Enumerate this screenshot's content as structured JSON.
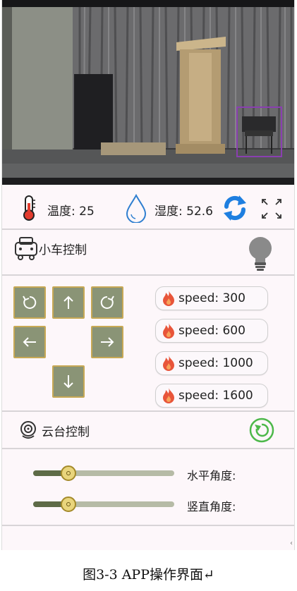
{
  "camera": {
    "feed_name": "camera-feed"
  },
  "sensors": {
    "temperature_label": "温度: 25",
    "humidity_label": "湿度: 52.6",
    "refresh_icon": "refresh-icon",
    "fullscreen_icon": "fullscreen-icon"
  },
  "car_control": {
    "title": "小车控制",
    "light_icon": "lightbulb-icon",
    "directions": [
      {
        "name": "rotate-left",
        "glyph": "⟲"
      },
      {
        "name": "forward",
        "glyph": "↑"
      },
      {
        "name": "rotate-right",
        "glyph": "⟳"
      },
      {
        "name": "left",
        "glyph": "←"
      },
      {
        "name": "right",
        "glyph": "→"
      },
      {
        "name": "backward",
        "glyph": "↓"
      }
    ],
    "speeds": [
      "speed: 300",
      "speed: 600",
      "speed: 1000",
      "speed: 1600"
    ]
  },
  "gimbal_control": {
    "title": "云台控制",
    "horizontal_label": "水平角度:",
    "vertical_label": "竖直角度:",
    "horizontal_value": 0.25,
    "vertical_value": 0.25
  },
  "caption": "图3-3 APP操作界面↵",
  "colors": {
    "accent_blue": "#1e7fe0",
    "button_green": "#8a9476",
    "button_border": "#c8a955",
    "flame": "#e8553a",
    "reset_green": "#4db84a"
  }
}
